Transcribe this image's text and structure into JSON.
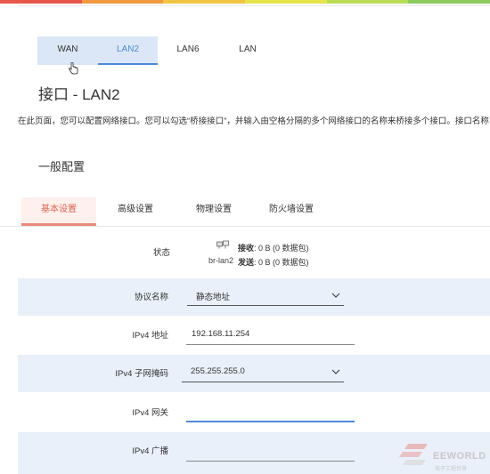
{
  "top_tabs": [
    {
      "label": "WAN"
    },
    {
      "label": "LAN2"
    },
    {
      "label": "LAN6"
    },
    {
      "label": "LAN"
    }
  ],
  "page_title": "接口 - LAN2",
  "description": "在此页面，您可以配置网络接口。您可以勾选“桥接接口”，并输入由空格分隔的多个网络接口的名称来桥接多个接口。接口名称",
  "section_title": "一般配置",
  "sub_tabs": [
    {
      "label": "基本设置"
    },
    {
      "label": "高级设置"
    },
    {
      "label": "物理设置"
    },
    {
      "label": "防火墙设置"
    }
  ],
  "status": {
    "label": "状态",
    "interface": "br-lan2",
    "rx_label": "接收",
    "rx_value": ": 0 B (0 数据包)",
    "tx_label": "发送",
    "tx_value": ": 0 B (0 数据包)"
  },
  "fields": {
    "protocol": {
      "label": "协议名称",
      "value": "静态地址"
    },
    "ipv4_address": {
      "label": "IPv4 地址",
      "value": "192.168.11.254"
    },
    "ipv4_netmask": {
      "label": "IPv4 子网掩码",
      "value": "255.255.255.0"
    },
    "ipv4_gateway": {
      "label": "IPv4 网关",
      "value": ""
    },
    "ipv4_broadcast": {
      "label": "IPv4 广播",
      "value": ""
    }
  },
  "watermark": {
    "text": "EEWORLD",
    "sub": "电子工程世界"
  },
  "colors": {
    "rainbow": [
      "#e8574b",
      "#f19a3f",
      "#f3c441",
      "#e7e44c",
      "#b8dd55",
      "#8ccc5e"
    ],
    "accent_blue": "#4b89dc",
    "accent_red": "#e1634e",
    "row_shade": "#e9f0f9"
  },
  "icons": {
    "cursor": "hand-pointer-icon",
    "network": "network-ports-icon",
    "select": "chevron-down-icon"
  }
}
